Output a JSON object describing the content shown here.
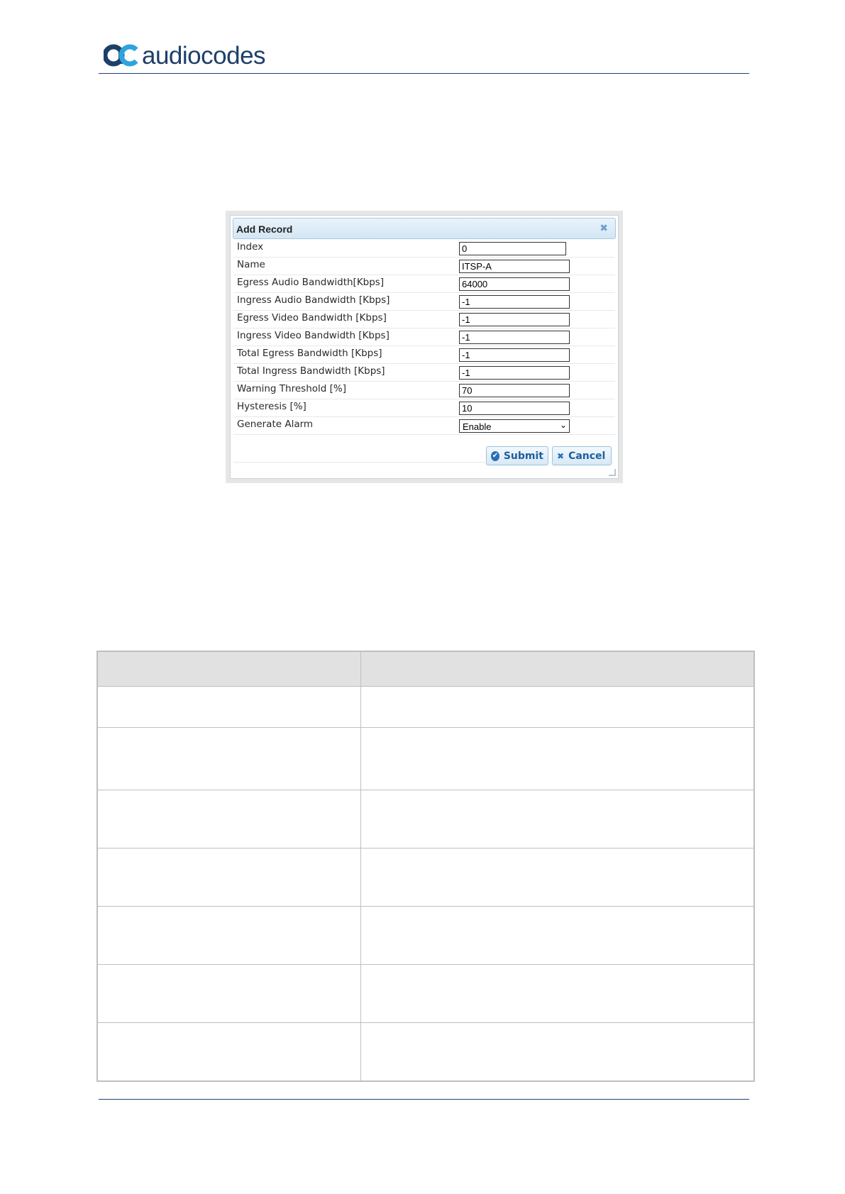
{
  "brand": {
    "name": "audiocodes",
    "logo_icon": "audiocodes-ac-logo",
    "colors": {
      "text": "#1d3f6b",
      "mark_dark": "#1d3f6b",
      "mark_accent": "#2fa4dc"
    }
  },
  "dialog": {
    "title": "Add Record",
    "close_icon": "close-icon",
    "fields": [
      {
        "label": "Index",
        "value": "0"
      },
      {
        "label": "Name",
        "value": "ITSP-A"
      },
      {
        "label": "Egress Audio Bandwidth[Kbps]",
        "value": "64000"
      },
      {
        "label": "Ingress Audio Bandwidth [Kbps]",
        "value": "-1"
      },
      {
        "label": "Egress Video Bandwidth [Kbps]",
        "value": "-1"
      },
      {
        "label": "Ingress Video Bandwidth [Kbps]",
        "value": "-1"
      },
      {
        "label": "Total Egress Bandwidth [Kbps]",
        "value": "-1"
      },
      {
        "label": "Total Ingress Bandwidth [Kbps]",
        "value": "-1"
      },
      {
        "label": "Warning Threshold [%]",
        "value": "70"
      },
      {
        "label": "Hysteresis [%]",
        "value": "10"
      }
    ],
    "alarm": {
      "label": "Generate Alarm",
      "selected": "Enable"
    },
    "submit_label": "Submit",
    "cancel_label": "Cancel"
  },
  "table": {
    "header": [
      "",
      ""
    ],
    "rows": [
      [
        "",
        ""
      ],
      [
        "",
        ""
      ],
      [
        "",
        ""
      ],
      [
        "",
        ""
      ],
      [
        "",
        ""
      ],
      [
        "",
        ""
      ],
      [
        "",
        ""
      ]
    ]
  }
}
